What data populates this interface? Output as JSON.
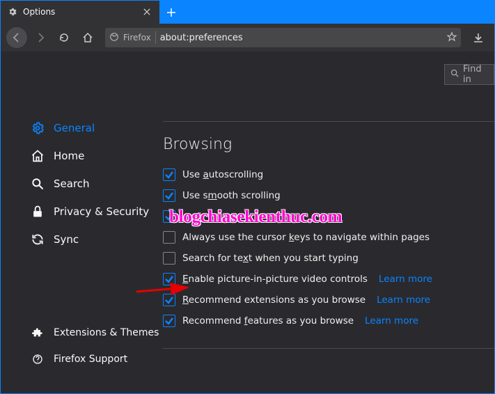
{
  "tab": {
    "title": "Options"
  },
  "url": {
    "identity": "Firefox",
    "address": "about:preferences"
  },
  "find": {
    "placeholder": "Find in"
  },
  "sidebar": {
    "items": [
      {
        "label": "General"
      },
      {
        "label": "Home"
      },
      {
        "label": "Search"
      },
      {
        "label": "Privacy & Security"
      },
      {
        "label": "Sync"
      }
    ],
    "footer": [
      {
        "label": "Extensions & Themes"
      },
      {
        "label": "Firefox Support"
      }
    ]
  },
  "section": {
    "title": "Browsing",
    "options": [
      {
        "label": "Use autoscrolling"
      },
      {
        "label": "Use smooth scrolling"
      },
      {
        "label": ""
      },
      {
        "label": "Always use the cursor keys to navigate within pages"
      },
      {
        "label": "Search for text when you start typing"
      },
      {
        "label": "Enable picture-in-picture video controls",
        "learn": "Learn more"
      },
      {
        "label": "Recommend extensions as you browse",
        "learn": "Learn more"
      },
      {
        "label": "Recommend features as you browse",
        "learn": "Learn more"
      }
    ]
  },
  "watermark": "blogchiasekienthuc.com"
}
